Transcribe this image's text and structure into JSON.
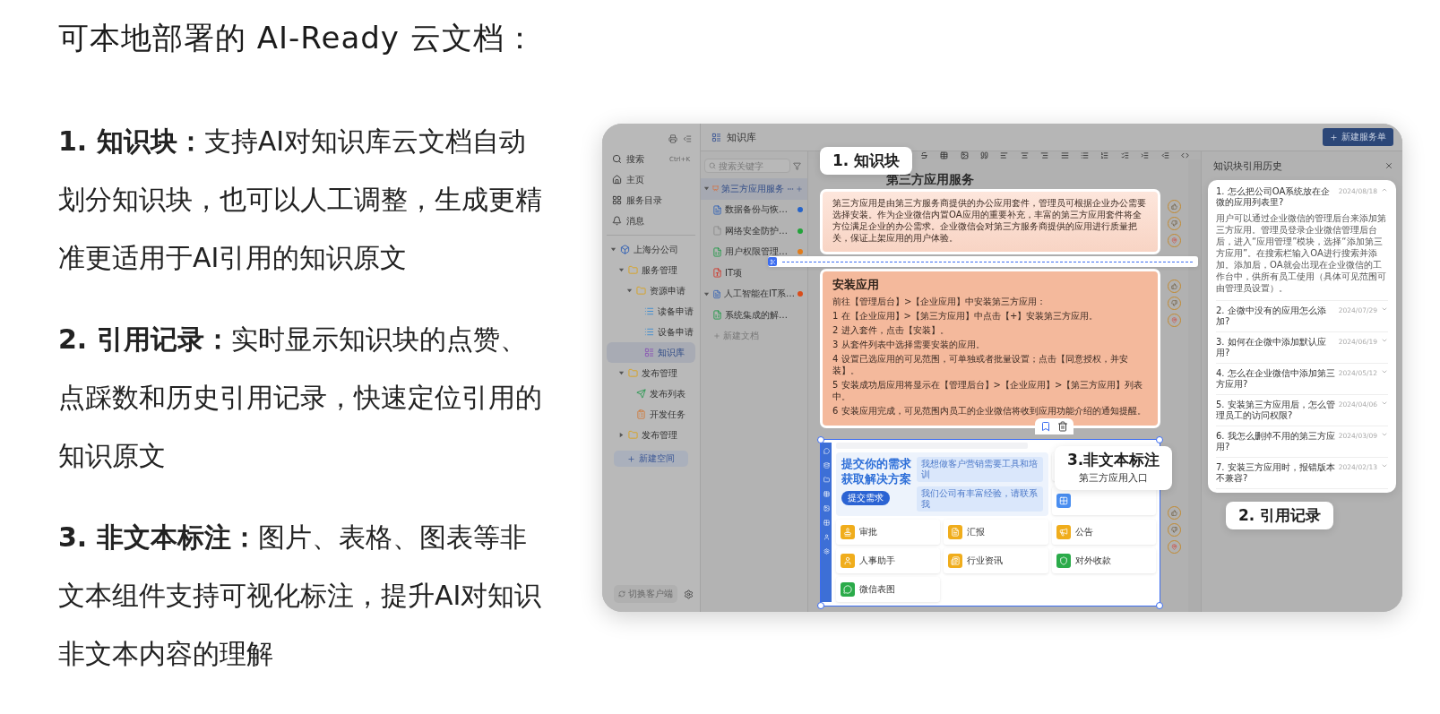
{
  "headline": "可本地部署的 AI-Ready 云文档：",
  "features": [
    "**1. 知识块：**支持AI对知识库云文档自动划分知识块，也可以人工调整，生成更精准更适用于AI引用的知识原文",
    "**2. 引用记录：**实时显示知识块的点赞、点踩数和历史引用记录，快速定位引用的知识原文",
    "**3. 非文本标注：**图片、表格、图表等非文本组件支持可视化标注，提升AI对知识非文本内容的理解"
  ],
  "app": {
    "sidebar": {
      "nav": [
        {
          "label": "搜索",
          "shortcut": "Ctrl+K",
          "kind": "search"
        },
        {
          "label": "主页",
          "kind": "home"
        },
        {
          "label": "服务目录",
          "kind": "catalog"
        },
        {
          "label": "消息",
          "kind": "bell"
        }
      ],
      "tree": [
        {
          "label": "上海分公司",
          "kind": "org",
          "expanded": true,
          "selected": false,
          "children": [
            {
              "label": "服务管理",
              "kind": "folder",
              "expanded": true,
              "selected": false,
              "children": [
                {
                  "label": "资源申请",
                  "kind": "folder",
                  "expanded": true,
                  "selected": false,
                  "children": [
                    {
                      "label": "读备申请",
                      "kind": "list",
                      "selected": false
                    },
                    {
                      "label": "设备申请",
                      "kind": "list",
                      "selected": false
                    },
                    {
                      "label": "知识库",
                      "kind": "kb",
                      "selected": true
                    }
                  ]
                }
              ]
            },
            {
              "label": "发布管理",
              "kind": "folder",
              "expanded": true,
              "selected": false,
              "children": [
                {
                  "label": "发布列表",
                  "kind": "send",
                  "selected": false
                },
                {
                  "label": "开发任务",
                  "kind": "task",
                  "selected": false
                }
              ]
            },
            {
              "label": "发布管理",
              "kind": "folder",
              "expanded": false,
              "selected": false
            }
          ]
        }
      ],
      "new_space": "新建空间",
      "switch_client": "切换客户端"
    },
    "header": {
      "title": "知识库",
      "new_button": "新建服务单"
    },
    "files": {
      "search_placeholder": "搜索关键字",
      "items": [
        {
          "label": "第三方应用服务",
          "kind": "ppt",
          "expanded": true,
          "selected": true,
          "children": [
            {
              "label": "数据备份与恢…",
              "kind": "word",
              "selected": false,
              "color": "#2563c9"
            },
            {
              "label": "网络安全防护…",
              "kind": "blank",
              "selected": false,
              "color": "#23a33a"
            },
            {
              "label": "用户权限管理…",
              "kind": "sheet",
              "selected": false,
              "color": "#e07b1a"
            },
            {
              "label": "IT项",
              "kind": "pdf",
              "selected": false
            }
          ]
        },
        {
          "label": "人工智能在IT系…",
          "kind": "word",
          "expanded": true,
          "selected": false,
          "color": "#d94c1a",
          "children": [
            {
              "label": "系统集成的解…",
              "kind": "sheet",
              "selected": false
            }
          ]
        }
      ],
      "new_doc": "新建文档"
    },
    "editor": {
      "callout": "1. 知识块",
      "title": "第三方应用服务",
      "blocks": [
        {
          "kind": "text",
          "body": "第三方应用是由第三方服务商提供的办公应用套件，管理员可根据企业办公需要选择安装。作为企业微信内置OA应用的重要补充，丰富的第三方应用套件将全方位满足企业的办公需求。企业微信会对第三方服务商提供的应用进行质量把关，保证上架应用的用户体验。"
        },
        {
          "kind": "steps",
          "heading": "安装应用",
          "intro": "前往【管理后台】>【企业应用】中安装第三方应用：",
          "steps": [
            "1 在【企业应用】>【第三方应用】中点击【+】安装第三方应用。",
            "2 进入套件，点击【安装】。",
            "3 从套件列表中选择需要安装的应用。",
            "4 设置已选应用的可见范围，可单独或者批量设置；点击【同意授权，并安装】。",
            "5 安装成功后应用将显示在【管理后台】>【企业应用】>【第三方应用】列表中。",
            "6 安装应用完成，可见范围内员工的企业微信将收到应用功能介绍的通知提醒。"
          ]
        },
        {
          "kind": "image",
          "banner_title": "提交你的需求",
          "banner_subtitle": "获取解决方案",
          "banner_button": "提交需求",
          "bubbles": [
            "我想做客户营销需要工具和培训",
            "我们公司有丰富经验，请联系我"
          ],
          "apps": [
            {
              "name": "审批",
              "color": "#f0ad1c"
            },
            {
              "name": "汇报",
              "color": "#f0ad1c"
            },
            {
              "name": "公告",
              "color": "#f0ad1c"
            },
            {
              "name": "人事助手",
              "color": "#f0ad1c"
            },
            {
              "name": "行业资讯",
              "color": "#f0ad1c"
            },
            {
              "name": "对外收款",
              "color": "#2bab4a"
            },
            {
              "name": "微信表图",
              "color": "#2bab4a"
            }
          ],
          "callout_title": "3.非文本标注",
          "callout_subtitle": "第三方应用入口"
        }
      ]
    },
    "history": {
      "title": "知识块引用历史",
      "callout": "2. 引用记录",
      "items": [
        {
          "question": "1. 怎么把公司OA系统放在企微的应用列表里?",
          "date": "2024/08/18",
          "expanded": true,
          "answer": "用户可以通过企业微信的管理后台来添加第三方应用。管理员登录企业微信管理后台后，进入“应用管理”模块，选择“添加第三方应用”。在搜索栏输入OA进行搜索并添加。添加后，OA就会出现在企业微信的工作台中，供所有员工使用（具体可见范围可由管理员设置）。"
        },
        {
          "question": "2. 企微中没有的应用怎么添加?",
          "date": "2024/07/29",
          "expanded": false
        },
        {
          "question": "3. 如何在企微中添加默认应用?",
          "date": "2024/06/19",
          "expanded": false
        },
        {
          "question": "4. 怎么在企业微信中添加第三方应用?",
          "date": "2024/05/12",
          "expanded": false
        },
        {
          "question": "5. 安装第三方应用后，怎么管理员工的访问权限?",
          "date": "2024/04/06",
          "expanded": false
        },
        {
          "question": "6. 我怎么删掉不用的第三方应用?",
          "date": "2024/03/09",
          "expanded": false
        },
        {
          "question": "7. 安装三方应用时，报错版本不兼容?",
          "date": "2024/02/13",
          "expanded": false
        }
      ]
    }
  }
}
